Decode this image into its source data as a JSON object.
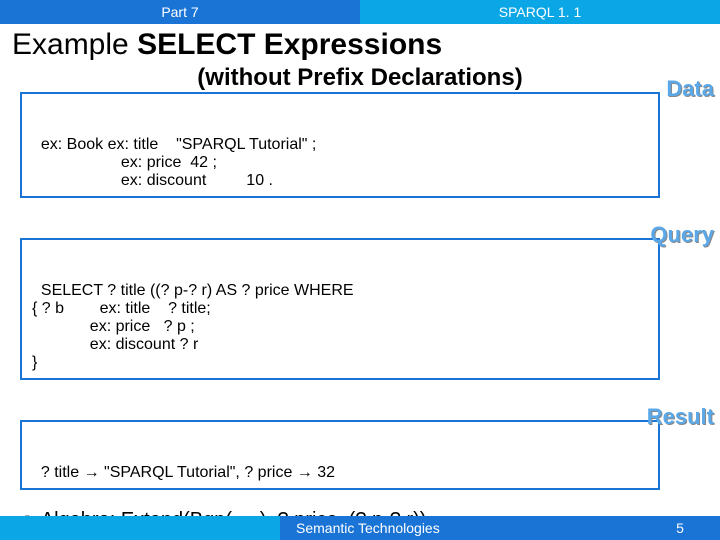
{
  "topbar": {
    "left": "Part 7",
    "right": "SPARQL 1. 1"
  },
  "title_prefix": "Example ",
  "title_bold": "SELECT Expressions",
  "subtitle": "(without Prefix Declarations)",
  "labels": {
    "data": "Data",
    "query": "Query",
    "result": "Result"
  },
  "data_box": "ex: Book ex: title    \"SPARQL Tutorial\" ;\n                    ex: price  42 ;\n                    ex: discount         10 .",
  "query_box": "SELECT ? title ((? p-? r) AS ? price WHERE\n{ ? b        ex: title    ? title;\n             ex: price   ? p ;\n             ex: discount ? r\n}",
  "result_box": "? title → \"SPARQL Tutorial\", ? price → 32",
  "algebra_line": "Algebra:  Extend(Bgp(. . .), ? price, (? p-? r))",
  "footer": {
    "mid": "Semantic Technologies",
    "page": "5"
  }
}
